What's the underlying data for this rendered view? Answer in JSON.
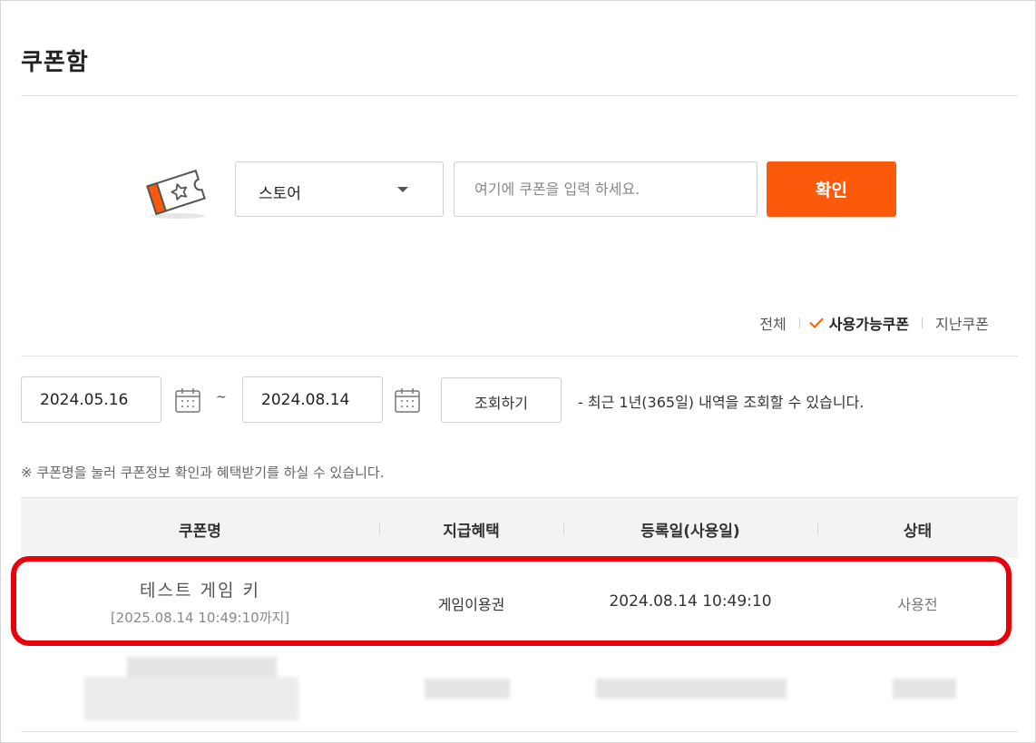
{
  "page": {
    "title": "쿠폰함"
  },
  "register": {
    "store_label": "스토어",
    "input_placeholder": "여기에 쿠폰을 입력 하세요.",
    "confirm_label": "확인"
  },
  "filters": {
    "all": "전체",
    "available": "사용가능쿠폰",
    "expired": "지난쿠폰",
    "active": "available"
  },
  "date_search": {
    "start": "2024.05.16",
    "end": "2024.08.14",
    "separator": "~",
    "search_label": "조회하기",
    "note": "- 최근 1년(365일) 내역을 조회할 수 있습니다."
  },
  "info_note": "※ 쿠폰명을 눌러 쿠폰정보 확인과 혜택받기를 하실 수 있습니다.",
  "table": {
    "headers": [
      "쿠폰명",
      "지급혜택",
      "등록일(사용일)",
      "상태"
    ],
    "rows": [
      {
        "name": "테스트 게임 키",
        "expiry": "[2025.08.14 10:49:10까지]",
        "benefit": "게임이용권",
        "registered": "2024.08.14 10:49:10",
        "status": "사용전"
      }
    ]
  },
  "colors": {
    "accent": "#fa5a0a",
    "highlight": "#e8000b"
  }
}
